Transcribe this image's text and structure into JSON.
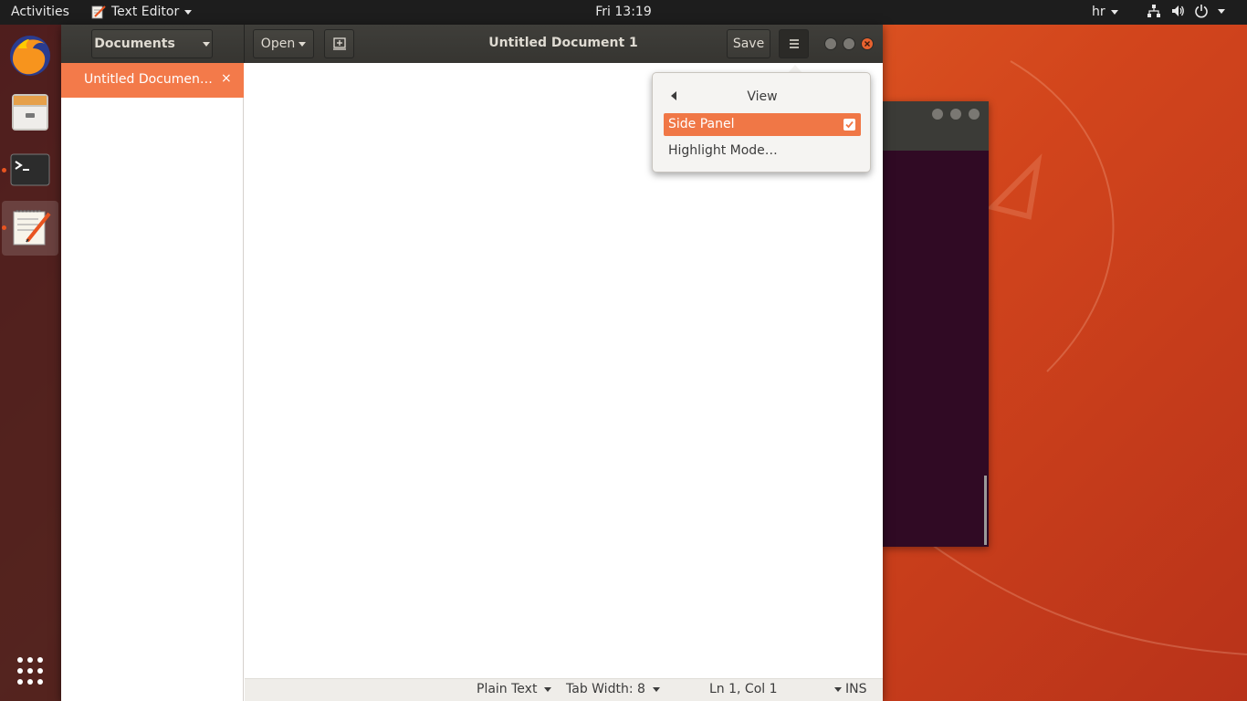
{
  "topbar": {
    "activities": "Activities",
    "app_name": "Text Editor",
    "clock": "Fri 13:19",
    "keyboard_layout": "hr"
  },
  "dock": {
    "items": [
      "firefox-icon",
      "files-icon",
      "terminal-icon",
      "text-editor-icon",
      "show-apps-icon"
    ]
  },
  "window": {
    "title": "Untitled Document 1",
    "documents_button": "Documents",
    "open_button": "Open",
    "save_button": "Save"
  },
  "sidebar": {
    "documents": [
      {
        "label": "Untitled Documen…",
        "close": "×"
      }
    ]
  },
  "popover": {
    "title": "View",
    "items": [
      {
        "label": "Side Panel",
        "checked": true
      },
      {
        "label": "Highlight Mode…"
      }
    ]
  },
  "statusbar": {
    "language": "Plain Text",
    "tab_width": "Tab Width: 8",
    "position": "Ln 1, Col 1",
    "mode": "INS"
  },
  "colors": {
    "accent": "#e95420",
    "selection": "#f37a4a",
    "headerbar": "#3b3a36"
  }
}
